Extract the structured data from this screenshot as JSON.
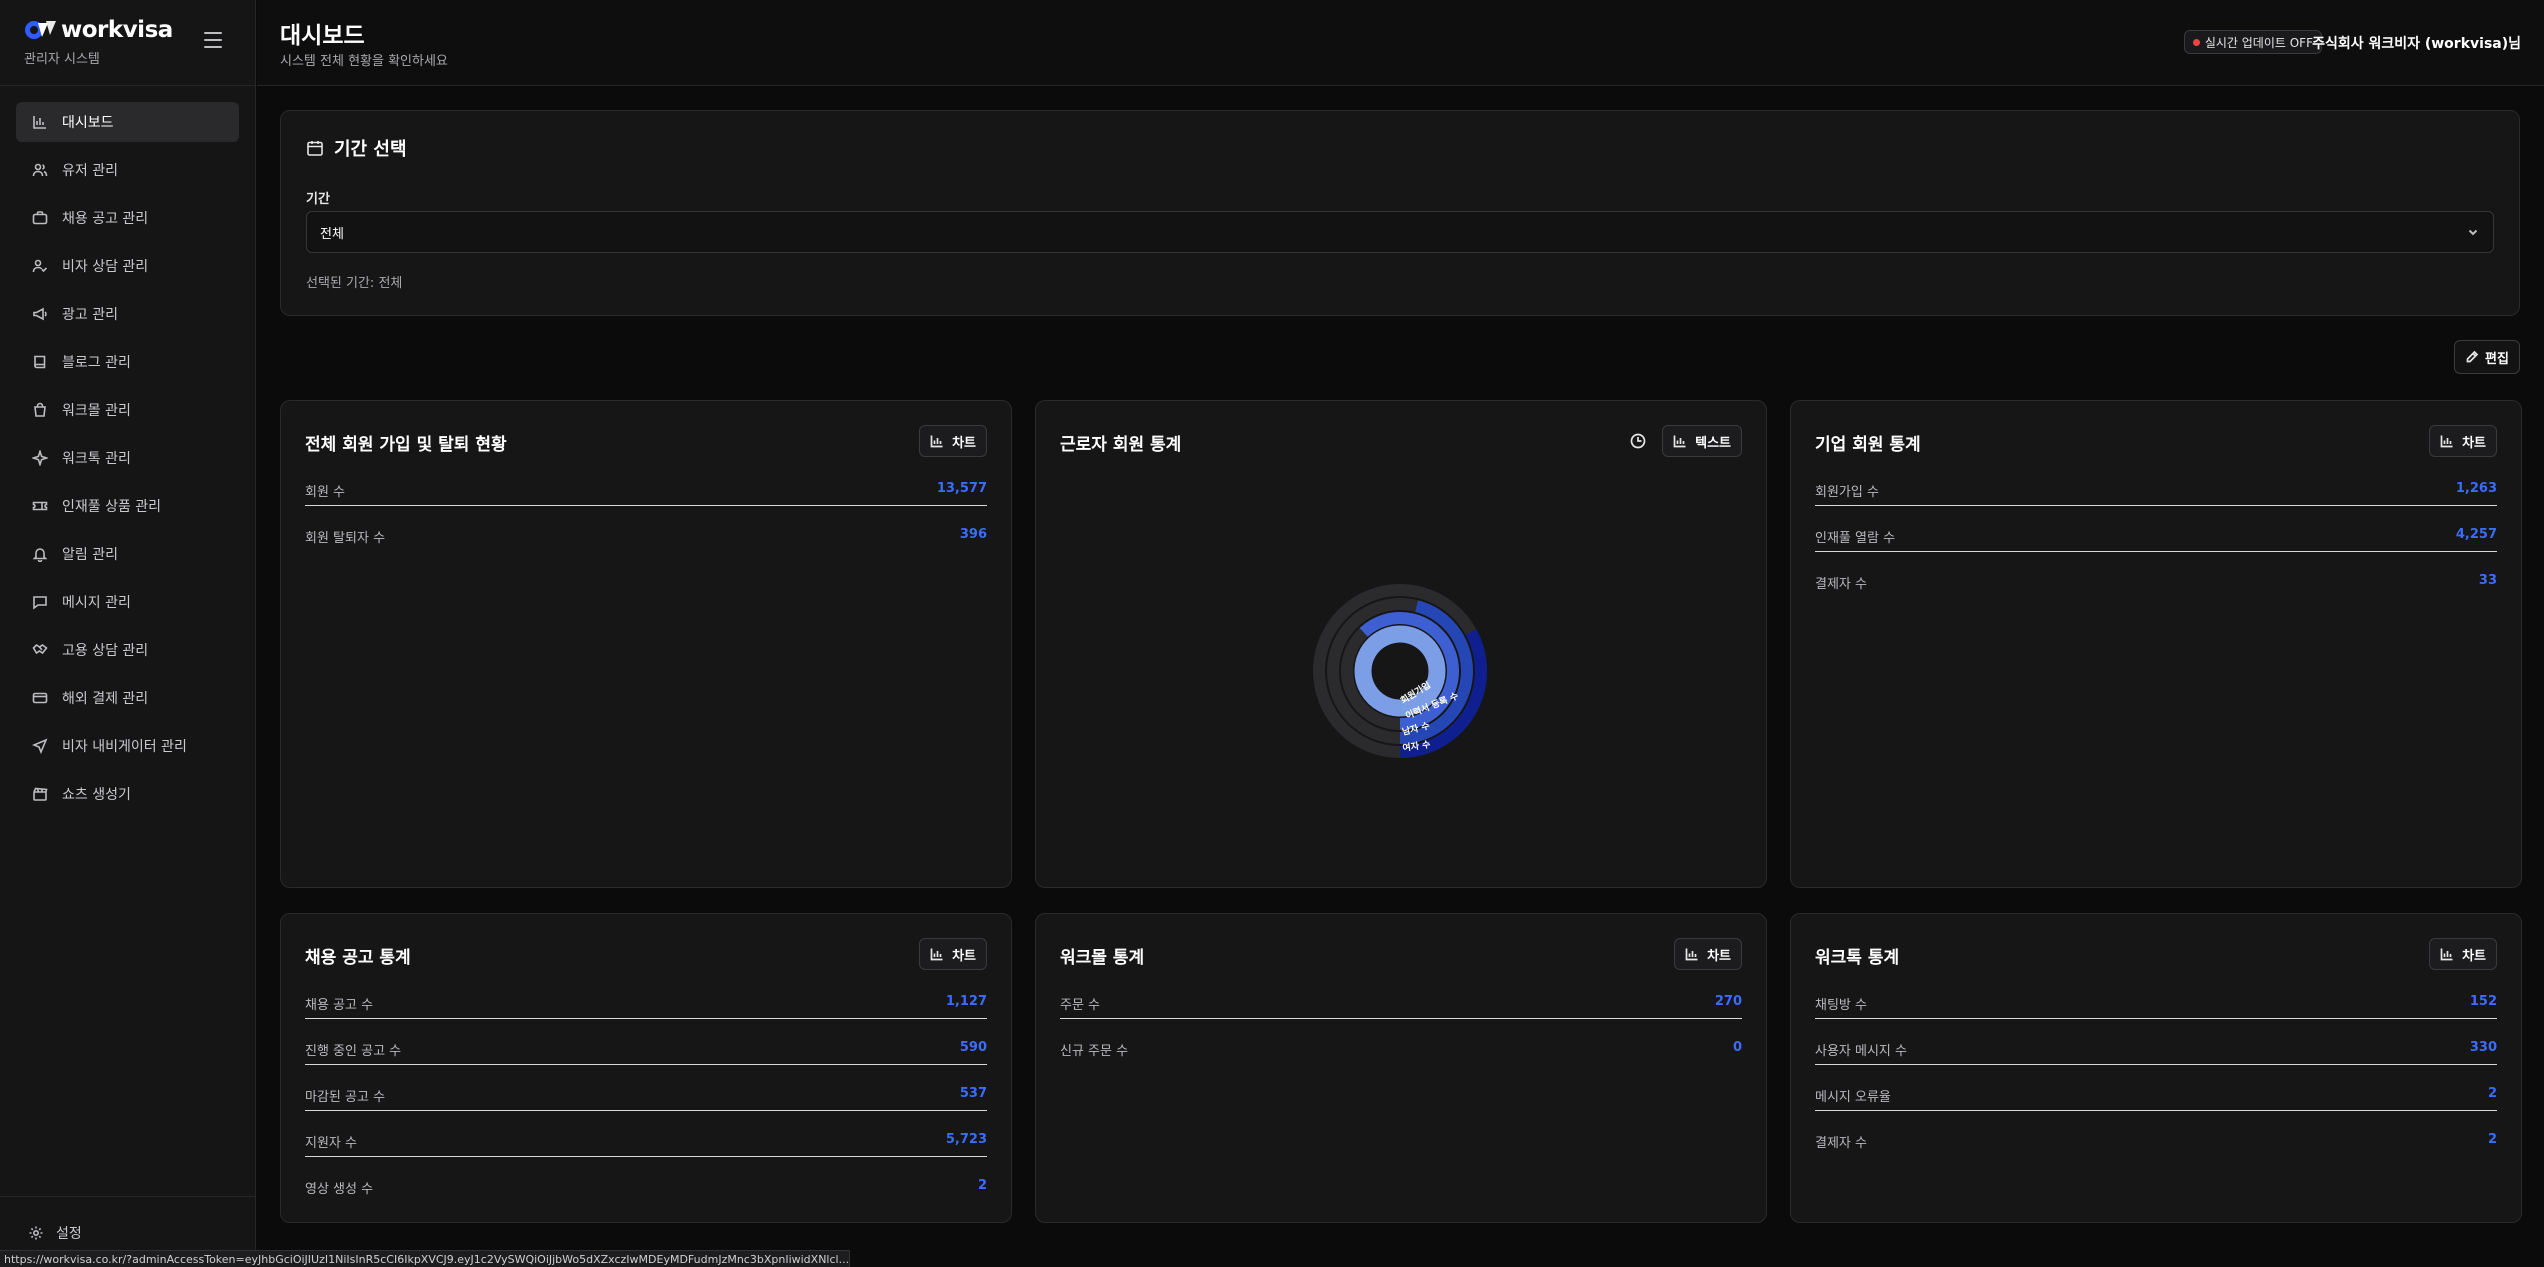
{
  "brand": {
    "name": "workvisa",
    "subtitle": "관리자 시스템"
  },
  "sidebar": {
    "items": [
      {
        "label": "대시보드",
        "icon": "bar-chart-icon"
      },
      {
        "label": "유저 관리",
        "icon": "users-icon"
      },
      {
        "label": "채용 공고 관리",
        "icon": "briefcase-icon"
      },
      {
        "label": "비자 상담 관리",
        "icon": "user-check-icon"
      },
      {
        "label": "광고 관리",
        "icon": "megaphone-icon"
      },
      {
        "label": "블로그 관리",
        "icon": "book-icon"
      },
      {
        "label": "워크몰 관리",
        "icon": "shopping-bag-icon"
      },
      {
        "label": "워크톡 관리",
        "icon": "sparkle-icon"
      },
      {
        "label": "인재풀 상품 관리",
        "icon": "ticket-icon"
      },
      {
        "label": "알림 관리",
        "icon": "bell-icon"
      },
      {
        "label": "메시지 관리",
        "icon": "message-icon"
      },
      {
        "label": "고용 상담 관리",
        "icon": "handshake-icon"
      },
      {
        "label": "해외 결제 관리",
        "icon": "credit-card-icon"
      },
      {
        "label": "비자 내비게이터 관리",
        "icon": "navigation-icon"
      },
      {
        "label": "쇼츠 생성기",
        "icon": "clapperboard-icon"
      }
    ],
    "settings_label": "설정"
  },
  "header": {
    "title": "대시보드",
    "subtitle": "시스템 전체 현황을 확인하세요",
    "live_badge": "실시간 업데이트 OFF",
    "company": "주식회사 워크비자 (workvisa)님"
  },
  "period": {
    "title": "기간 선택",
    "label": "기간",
    "selected_value": "전체",
    "selected_text": "선택된 기간: 전체"
  },
  "edit_label": "편집",
  "cards": {
    "members": {
      "title": "전체 회원 가입 및 탈퇴 현황",
      "button": "차트",
      "rows": [
        {
          "label": "회원 수",
          "value": "13,577"
        },
        {
          "label": "회원 탈퇴자 수",
          "value": "396"
        }
      ]
    },
    "workers": {
      "title": "근로자 회원 통계",
      "button": "텍스트",
      "ring_labels": [
        "회원가입",
        "이력서 등록 수",
        "남자 수",
        "여자 수"
      ]
    },
    "company": {
      "title": "기업 회원 통계",
      "button": "차트",
      "rows": [
        {
          "label": "회원가입 수",
          "value": "1,263"
        },
        {
          "label": "인재풀 열람 수",
          "value": "4,257"
        },
        {
          "label": "결제자 수",
          "value": "33"
        }
      ]
    },
    "jobs": {
      "title": "채용 공고 통계",
      "button": "차트",
      "rows": [
        {
          "label": "채용 공고 수",
          "value": "1,127"
        },
        {
          "label": "진행 중인 공고 수",
          "value": "590"
        },
        {
          "label": "마감된 공고 수",
          "value": "537"
        },
        {
          "label": "지원자 수",
          "value": "5,723"
        },
        {
          "label": "영상 생성 수",
          "value": "2"
        }
      ]
    },
    "workmall": {
      "title": "워크몰 통계",
      "button": "차트",
      "rows": [
        {
          "label": "주문 수",
          "value": "270"
        },
        {
          "label": "신규 주문 수",
          "value": "0"
        }
      ]
    },
    "worktalk": {
      "title": "워크톡 통계",
      "button": "차트",
      "rows": [
        {
          "label": "채팅방 수",
          "value": "152"
        },
        {
          "label": "사용자 메시지 수",
          "value": "330"
        },
        {
          "label": "메시지 오류율",
          "value": "2"
        },
        {
          "label": "결제자 수",
          "value": "2"
        }
      ]
    }
  },
  "chart_data": {
    "type": "pie",
    "categories": [
      "회원가입",
      "이력서 등록 수",
      "남자 수",
      "여자 수"
    ],
    "fractions": [
      1.0,
      0.62,
      0.46,
      0.33
    ],
    "colors": [
      "#7b9ee6",
      "#3d5fd1",
      "#2447b5",
      "#0f1f8f"
    ]
  },
  "status_url": "https://workvisa.co.kr/?adminAccessToken=eyJhbGciOiJIUzI1NiIsInR5cCI6IkpXVCJ9.eyJ1c2VySWQiOiJjbWo5dXZxczIwMDEyMDFudmJzMnc3bXpnIiwidXNlcl..."
}
